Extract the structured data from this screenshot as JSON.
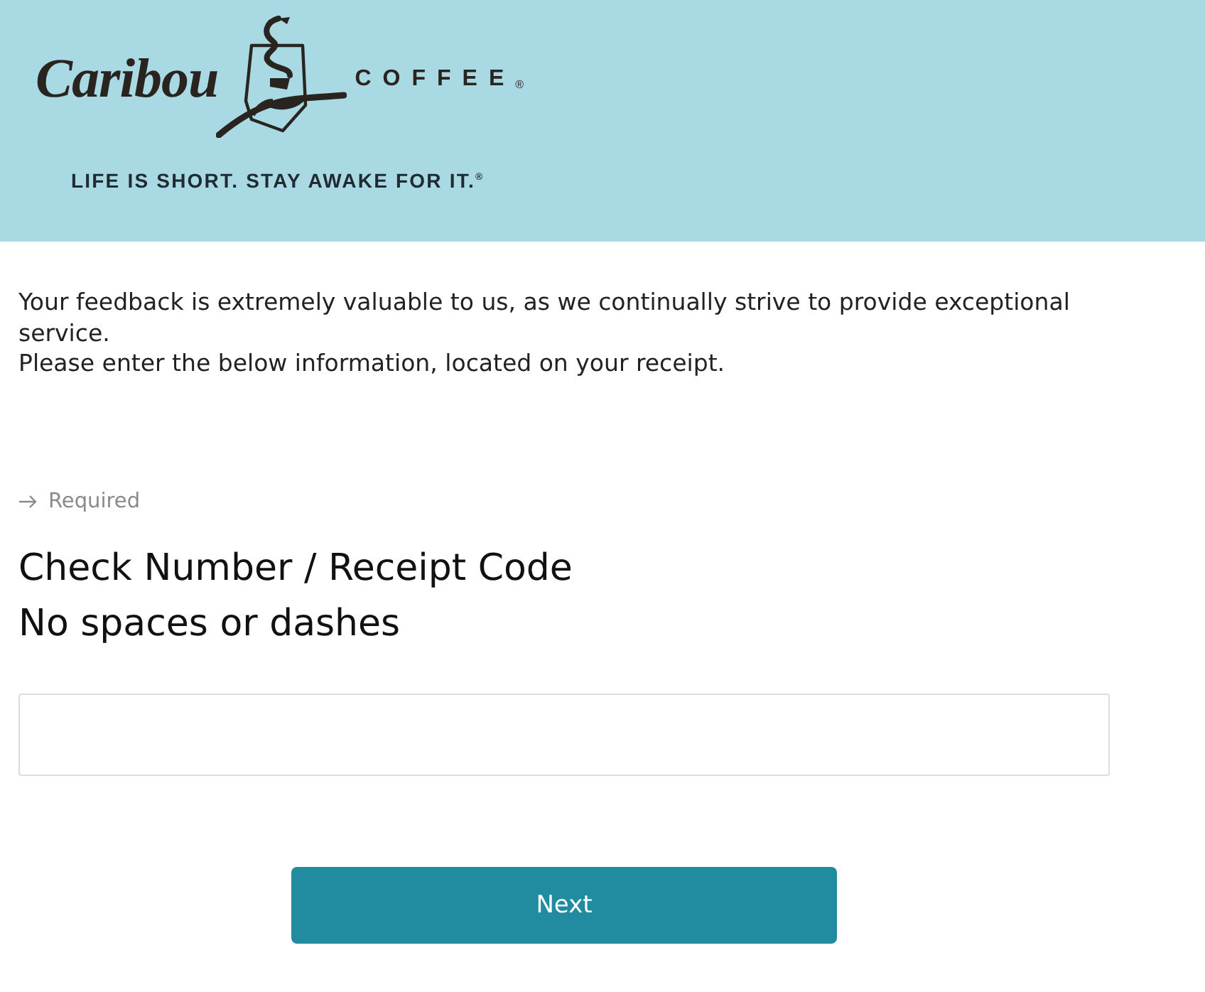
{
  "header": {
    "logo": {
      "script": "Caribou",
      "wordmark": "COFFEE",
      "registered": "®"
    },
    "tagline": "LIFE IS SHORT. STAY AWAKE FOR IT.$^{®}$"
  },
  "intro": [
    "Your feedback is extremely valuable to us, as we continually strive to provide exceptional service.",
    "Please enter the below information, located on your receipt."
  ],
  "required_note": "Required",
  "question": {
    "title": "Check Number / Receipt Code",
    "hint": "No spaces or dashes"
  },
  "next_button": {
    "label": "Next"
  }
}
